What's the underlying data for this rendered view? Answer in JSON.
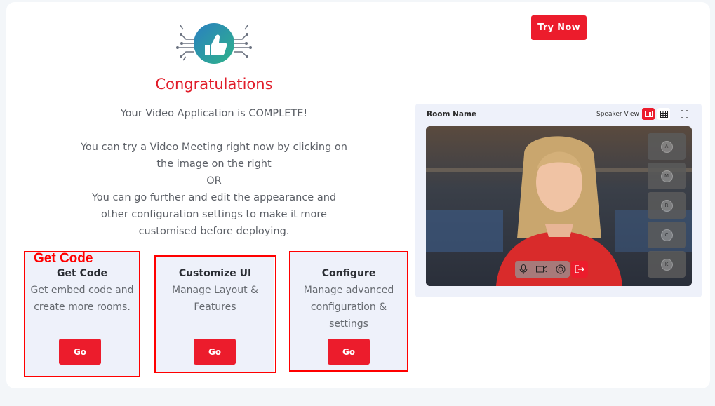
{
  "congrats_title": "Congratulations",
  "intro": {
    "line1": "Your Video Application is COMPLETE!",
    "line2": "You can try a Video Meeting right now by clicking on",
    "line3": "the image on the right",
    "line4": "OR",
    "line5": "You can go further and edit the appearance and",
    "line6": "other configuration settings to make it more",
    "line7": "customised before deploying."
  },
  "annotation_label": "Get Code",
  "try_now_label": "Try Now",
  "options": [
    {
      "title": "Get Code",
      "desc1": "Get embed code and",
      "desc2": "create more rooms.",
      "desc3": "",
      "button": "Go"
    },
    {
      "title": "Customize UI",
      "desc1": "Manage Layout &",
      "desc2": "Features",
      "desc3": "",
      "button": "Go"
    },
    {
      "title": "Configure",
      "desc1": "Manage advanced",
      "desc2": "configuration &",
      "desc3": "settings",
      "button": "Go"
    }
  ],
  "preview": {
    "room_name": "Room Name",
    "view_label": "Speaker View",
    "participants": [
      "A",
      "M",
      "R",
      "C",
      "K"
    ]
  },
  "colors": {
    "accent": "#ec1c2c",
    "annotation": "#ff0000",
    "panel": "#eef1fa"
  }
}
